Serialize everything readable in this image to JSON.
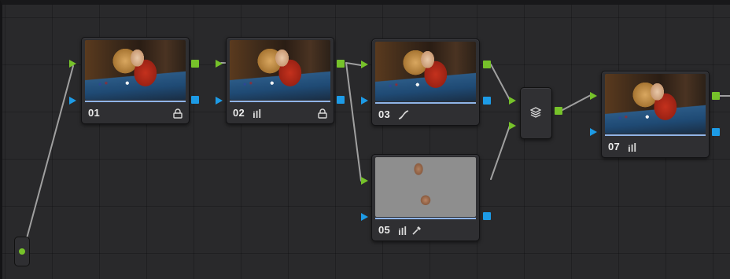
{
  "nodes": [
    {
      "id": "01",
      "label": "01",
      "icons": [
        "lock-icon"
      ]
    },
    {
      "id": "02",
      "label": "02",
      "icons": [
        "bars-icon",
        "lock-icon"
      ]
    },
    {
      "id": "03",
      "label": "03",
      "icons": [
        "curves-icon"
      ]
    },
    {
      "id": "05",
      "label": "05",
      "icons": [
        "bars-icon",
        "picker-icon"
      ]
    },
    {
      "id": "07",
      "label": "07",
      "icons": [
        "bars-icon"
      ]
    }
  ],
  "layer_mixer": {
    "icon": "layers-icon"
  },
  "colors": {
    "rgb_port": "#76c22a",
    "alpha_port": "#1d9be6",
    "wire": "#9a9a9a",
    "node_bg": "#2f2f32",
    "canvas_bg": "#29292b"
  }
}
